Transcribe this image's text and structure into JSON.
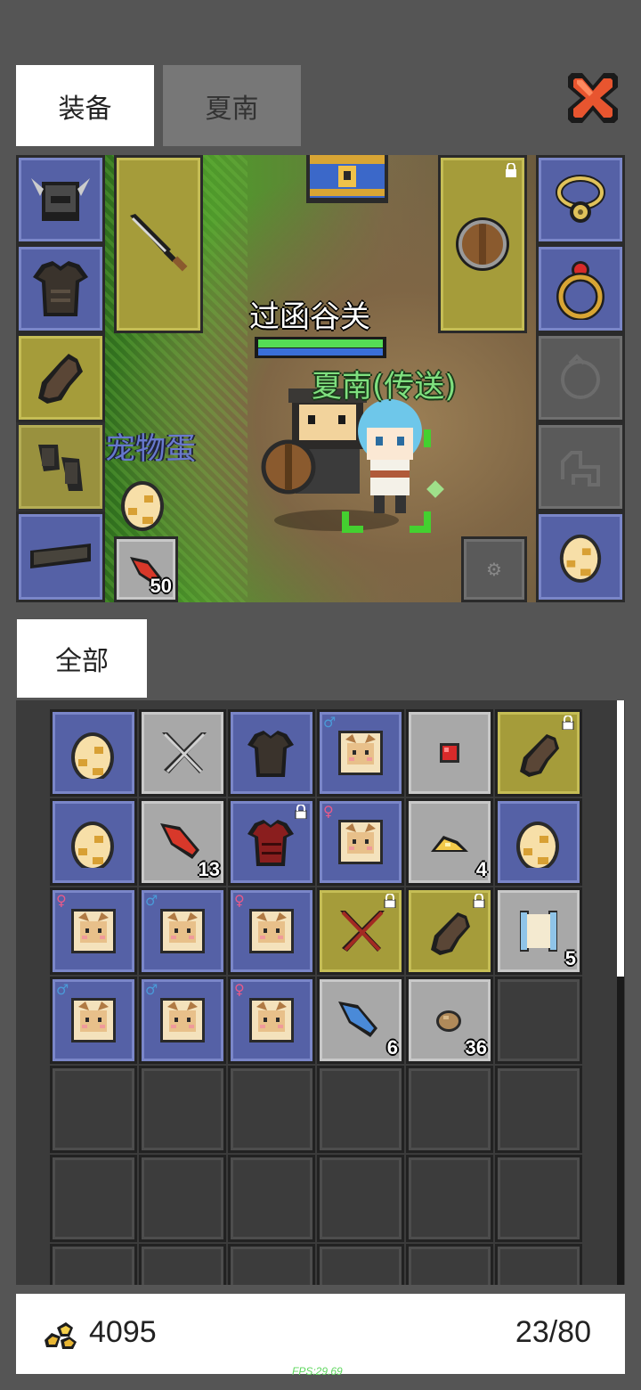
{
  "tabs": [
    {
      "label": "装备",
      "active": true
    },
    {
      "label": "夏南",
      "active": false
    }
  ],
  "scene": {
    "location_name": "过函谷关",
    "companion_label": "夏南(传送)",
    "pet_egg_label": "宠物蛋",
    "bait_count": "50"
  },
  "filter": {
    "label": "全部"
  },
  "inventory": {
    "rows": [
      [
        {
          "icon": "egg-icon",
          "bg": "blue"
        },
        {
          "icon": "crossed-swords-icon",
          "bg": "gray"
        },
        {
          "icon": "dark-armor-icon",
          "bg": "blue"
        },
        {
          "icon": "fox-card-icon",
          "bg": "blue",
          "gender": "♂"
        },
        {
          "icon": "red-gem-icon",
          "bg": "gray"
        },
        {
          "icon": "glove-icon",
          "bg": "yellow",
          "locked": true
        }
      ],
      [
        {
          "icon": "egg-icon",
          "bg": "blue"
        },
        {
          "icon": "red-feather-icon",
          "bg": "gray",
          "count": "13"
        },
        {
          "icon": "red-armor-icon",
          "bg": "blue",
          "locked": true
        },
        {
          "icon": "fox-card-icon",
          "bg": "blue",
          "gender": "♀"
        },
        {
          "icon": "gold-ore-icon",
          "bg": "gray",
          "count": "4"
        },
        {
          "icon": "egg-icon",
          "bg": "blue"
        }
      ],
      [
        {
          "icon": "fox-card-icon",
          "bg": "blue",
          "gender": "♀"
        },
        {
          "icon": "fox-card-icon",
          "bg": "blue",
          "gender": "♂"
        },
        {
          "icon": "fox-card-icon",
          "bg": "blue",
          "gender": "♀"
        },
        {
          "icon": "red-crossed-swords-icon",
          "bg": "yellow",
          "locked": true
        },
        {
          "icon": "glove-icon",
          "bg": "yellow",
          "locked": true
        },
        {
          "icon": "scroll-icon",
          "bg": "gray",
          "count": "5"
        }
      ],
      [
        {
          "icon": "fox-card-icon",
          "bg": "blue",
          "gender": "♂"
        },
        {
          "icon": "fox-card-icon",
          "bg": "blue",
          "gender": "♂"
        },
        {
          "icon": "fox-card-icon",
          "bg": "blue",
          "gender": "♀"
        },
        {
          "icon": "blue-feather-icon",
          "bg": "gray",
          "count": "6"
        },
        {
          "icon": "stone-icon",
          "bg": "gray",
          "count": "36"
        },
        {
          "icon": "",
          "bg": "empty"
        }
      ]
    ],
    "empty_rows": 3
  },
  "footer": {
    "gold": "4095",
    "capacity": "23/80"
  },
  "fps": "FPS:29.69",
  "colors": {
    "background": "#555555",
    "slot_blue": "#5561a6",
    "slot_yellow": "#a59c3a",
    "slot_gray": "#a8a8a8",
    "hp_green": "#55dd55",
    "label_green": "#7fe07f"
  }
}
